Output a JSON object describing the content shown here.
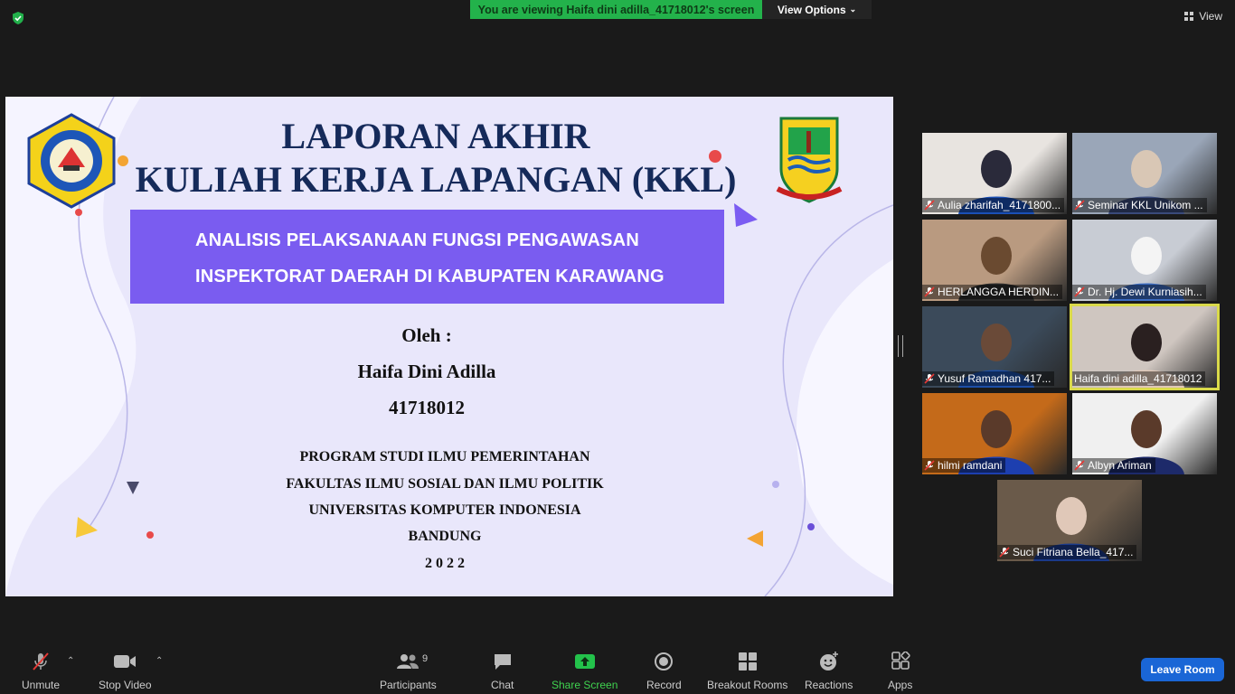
{
  "banner": {
    "viewing": "You are viewing Haifa dini adilla_41718012's screen",
    "view_options": "View Options"
  },
  "top_view_label": "View",
  "slide": {
    "title_line1": "LAPORAN AKHIR",
    "title_line2": "KULIAH KERJA LAPANGAN (KKL)",
    "subject_line1": "ANALISIS PELAKSANAAN FUNGSI PENGAWASAN",
    "subject_line2": "INSPEKTORAT DAERAH DI KABUPATEN KARAWANG",
    "by_label": "Oleh :",
    "author": "Haifa Dini Adilla",
    "nim": "41718012",
    "program": "PROGRAM STUDI ILMU PEMERINTAHAN",
    "faculty": "FAKULTAS ILMU SOSIAL DAN ILMU POLITIK",
    "university": "UNIVERSITAS KOMPUTER INDONESIA",
    "city": "BANDUNG",
    "year": "2 0 2 2",
    "logo_left_text_ring": "UNIVERSITAS KOMPUTER INDONESIA",
    "logo_left_text": "UNIKOM",
    "logo_right_text_top": "KABUPATEN KARAWANG",
    "logo_right_text_bottom": "PANGKAL PERJUANGAN"
  },
  "participants": [
    {
      "name": "Aulia zharifah_4171800...",
      "muted": true
    },
    {
      "name": "Seminar KKL Unikom ...",
      "muted": true
    },
    {
      "name": "HERLANGGA HERDIN...",
      "muted": true
    },
    {
      "name": "Dr. Hj. Dewi Kurniasih...",
      "muted": true
    },
    {
      "name": "Yusuf Ramadhan 417...",
      "muted": true
    },
    {
      "name": "Haifa dini adilla_41718012",
      "muted": false,
      "active": true
    },
    {
      "name": "hilmi ramdani",
      "muted": true
    },
    {
      "name": "Albyn Ariman",
      "muted": true
    },
    {
      "name": "Suci Fitriana Bella_417...",
      "muted": true
    }
  ],
  "toolbar": {
    "unmute": "Unmute",
    "stop_video": "Stop Video",
    "participants": "Participants",
    "participants_count": "9",
    "chat": "Chat",
    "share_screen": "Share Screen",
    "record": "Record",
    "breakout_rooms": "Breakout Rooms",
    "reactions": "Reactions",
    "apps": "Apps",
    "leave": "Leave Room"
  },
  "colors": {
    "banner_green": "#23b24b",
    "slide_purple": "#7a5cf0",
    "leave_blue": "#1a66d6",
    "active_border": "#d9d94a"
  }
}
